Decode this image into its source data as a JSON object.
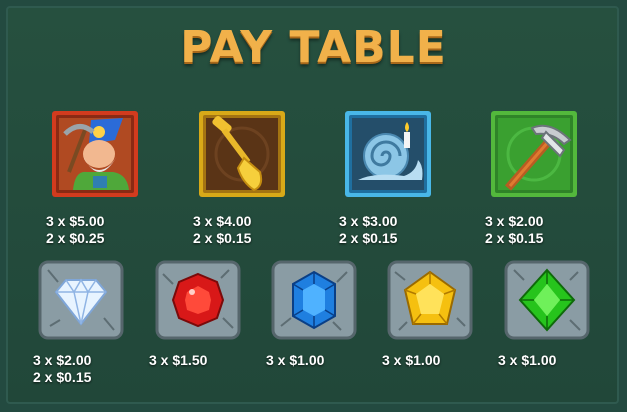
{
  "title": "PAY TABLE",
  "colors": {
    "background": "#234a40",
    "title": "#f1b14a",
    "payout_text": "#ffffff"
  },
  "high_symbols": [
    {
      "name": "miner",
      "icon": "miner-dwarf-icon",
      "frame_color": "#d23b1e",
      "pays": [
        "3 x $5.00",
        "2 x $0.25"
      ]
    },
    {
      "name": "shovel",
      "icon": "golden-shovel-icon",
      "frame_color": "#d8a918",
      "pays": [
        "3 x $4.00",
        "2 x $0.15"
      ]
    },
    {
      "name": "snail",
      "icon": "snail-lamp-icon",
      "frame_color": "#49b7e8",
      "pays": [
        "3 x $3.00",
        "2 x $0.15"
      ]
    },
    {
      "name": "pickaxe",
      "icon": "pickaxe-icon",
      "frame_color": "#53b83c",
      "pays": [
        "3 x $2.00",
        "2 x $0.15"
      ]
    }
  ],
  "low_symbols": [
    {
      "name": "diamond",
      "icon": "white-diamond-icon",
      "gem_color": "#d8ecff",
      "pays": [
        "3 x $2.00",
        "2 x $0.15"
      ]
    },
    {
      "name": "ruby",
      "icon": "red-gem-icon",
      "gem_color": "#d81818",
      "pays": [
        "3 x $1.50"
      ]
    },
    {
      "name": "sapphire",
      "icon": "blue-gem-icon",
      "gem_color": "#1f7fe0",
      "pays": [
        "3 x $1.00"
      ]
    },
    {
      "name": "topaz",
      "icon": "yellow-gem-icon",
      "gem_color": "#f5c010",
      "pays": [
        "3 x $1.00"
      ]
    },
    {
      "name": "emerald",
      "icon": "green-gem-icon",
      "gem_color": "#26c41c",
      "pays": [
        "3 x $1.00"
      ]
    }
  ]
}
